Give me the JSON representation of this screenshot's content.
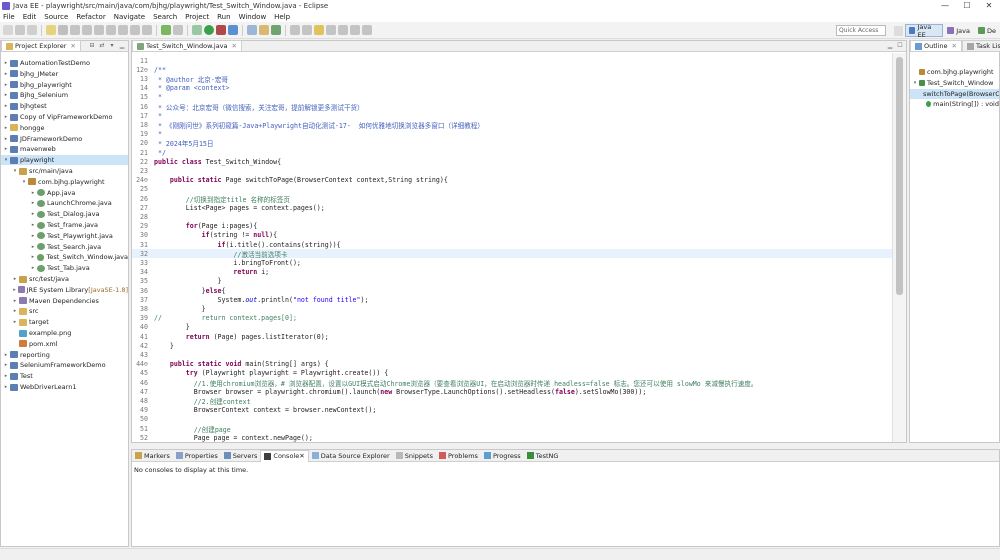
{
  "window": {
    "title": "Java EE - playwright/src/main/java/com/bjhg/playwright/Test_Switch_Window.java - Eclipse"
  },
  "menu": [
    "File",
    "Edit",
    "Source",
    "Refactor",
    "Navigate",
    "Search",
    "Project",
    "Run",
    "Window",
    "Help"
  ],
  "toolbar": {
    "quick_access": "Quick Access"
  },
  "perspectives": [
    {
      "label": "Java EE",
      "active": true
    },
    {
      "label": "Java",
      "active": false
    },
    {
      "label": "De",
      "active": false
    }
  ],
  "project_explorer": {
    "tab_label": "Project Explorer",
    "items": [
      {
        "label": "AutomationTestDemo",
        "depth": 0,
        "arrow": "▸",
        "icon": "project"
      },
      {
        "label": "bjhg_JMeter",
        "depth": 0,
        "arrow": "▸",
        "icon": "project"
      },
      {
        "label": "bjhg_playwright",
        "depth": 0,
        "arrow": "▸",
        "icon": "project"
      },
      {
        "label": "Bjhg_Selenium",
        "depth": 0,
        "arrow": "▸",
        "icon": "project"
      },
      {
        "label": "bjhgtest",
        "depth": 0,
        "arrow": "▸",
        "icon": "project"
      },
      {
        "label": "Copy of VipFrameworkDemo",
        "depth": 0,
        "arrow": "▸",
        "icon": "project"
      },
      {
        "label": "hongge",
        "depth": 0,
        "arrow": "▸",
        "icon": "folder"
      },
      {
        "label": "JDFrameworkDemo",
        "depth": 0,
        "arrow": "▸",
        "icon": "project"
      },
      {
        "label": "mavenweb",
        "depth": 0,
        "arrow": "▸",
        "icon": "project"
      },
      {
        "label": "playwright",
        "depth": 0,
        "arrow": "▾",
        "icon": "project",
        "selected": true
      },
      {
        "label": "src/main/java",
        "depth": 1,
        "arrow": "▾",
        "icon": "srcfolder"
      },
      {
        "label": "com.bjhg.playwright",
        "depth": 2,
        "arrow": "▾",
        "icon": "package"
      },
      {
        "label": "App.java",
        "depth": 3,
        "arrow": "▸",
        "icon": "java"
      },
      {
        "label": "LaunchChrome.java",
        "depth": 3,
        "arrow": "▸",
        "icon": "java"
      },
      {
        "label": "Test_Dialog.java",
        "depth": 3,
        "arrow": "▸",
        "icon": "java"
      },
      {
        "label": "Test_frame.java",
        "depth": 3,
        "arrow": "▸",
        "icon": "java"
      },
      {
        "label": "Test_Playwright.java",
        "depth": 3,
        "arrow": "▸",
        "icon": "java"
      },
      {
        "label": "Test_Search.java",
        "depth": 3,
        "arrow": "▸",
        "icon": "java"
      },
      {
        "label": "Test_Switch_Window.java",
        "depth": 3,
        "arrow": "▸",
        "icon": "java"
      },
      {
        "label": "Test_Tab.java",
        "depth": 3,
        "arrow": "▸",
        "icon": "java"
      },
      {
        "label": "src/test/java",
        "depth": 1,
        "arrow": "▸",
        "icon": "srcfolder"
      },
      {
        "label": "JRE System Library",
        "decoration": "[JavaSE-1.8]",
        "depth": 1,
        "arrow": "▸",
        "icon": "library"
      },
      {
        "label": "Maven Dependencies",
        "depth": 1,
        "arrow": "▸",
        "icon": "library"
      },
      {
        "label": "src",
        "depth": 1,
        "arrow": "▸",
        "icon": "folder"
      },
      {
        "label": "target",
        "depth": 1,
        "arrow": "▸",
        "icon": "folder"
      },
      {
        "label": "example.png",
        "depth": 1,
        "arrow": "",
        "icon": "image"
      },
      {
        "label": "pom.xml",
        "depth": 1,
        "arrow": "",
        "icon": "xml"
      },
      {
        "label": "reporting",
        "depth": 0,
        "arrow": "▸",
        "icon": "project"
      },
      {
        "label": "SeleniumFrameworkDemo",
        "depth": 0,
        "arrow": "▸",
        "icon": "project"
      },
      {
        "label": "Test",
        "depth": 0,
        "arrow": "▸",
        "icon": "project"
      },
      {
        "label": "WebDriverLearn1",
        "depth": 0,
        "arrow": "▸",
        "icon": "project"
      }
    ]
  },
  "editor": {
    "tab_label": "Test_Switch_Window.java",
    "highlight_line": 32,
    "lines": [
      {
        "n": "11",
        "t": "",
        "c": ""
      },
      {
        "n": "12⊖",
        "t": "/**",
        "c": "jd"
      },
      {
        "n": "13",
        "t": " * @author 北京-宏哥",
        "c": "jd"
      },
      {
        "n": "14",
        "t": " * @param <context>",
        "c": "jd"
      },
      {
        "n": "15",
        "t": " *",
        "c": "jd"
      },
      {
        "n": "16",
        "t": " * 公众号：北京宏哥（微信搜索，关注宏哥，提前解锁更多测试干货）",
        "c": "jd"
      },
      {
        "n": "17",
        "t": " *",
        "c": "jd"
      },
      {
        "n": "18",
        "t": " * 《刚刚问世》系列初窥篇-Java+Playwright自动化测试-17-  如何优雅地切换浏览器多窗口（详细教程）",
        "c": "jd"
      },
      {
        "n": "19",
        "t": " *",
        "c": "jd"
      },
      {
        "n": "20",
        "t": " * 2024年5月15日",
        "c": "jd"
      },
      {
        "n": "21",
        "t": " */",
        "c": "jd"
      },
      {
        "n": "22",
        "t": "public class Test_Switch_Window{",
        "c": ""
      },
      {
        "n": "23",
        "t": "",
        "c": ""
      },
      {
        "n": "24⊖",
        "t": "    public static Page switchToPage(BrowserContext context,String string){",
        "c": ""
      },
      {
        "n": "25",
        "t": "",
        "c": ""
      },
      {
        "n": "26",
        "t": "        //切换到指定title 名称的标签页",
        "c": "cm"
      },
      {
        "n": "27",
        "t": "        List<Page> pages = context.pages();",
        "c": ""
      },
      {
        "n": "28",
        "t": "",
        "c": ""
      },
      {
        "n": "29",
        "t": "        for(Page i:pages){",
        "c": ""
      },
      {
        "n": "30",
        "t": "            if(string != null){",
        "c": ""
      },
      {
        "n": "31",
        "t": "                if(i.title().contains(string)){",
        "c": ""
      },
      {
        "n": "32",
        "t": "                    //激活当前选项卡",
        "c": "cm"
      },
      {
        "n": "33",
        "t": "                    i.bringToFront();",
        "c": ""
      },
      {
        "n": "34",
        "t": "                    return i;",
        "c": ""
      },
      {
        "n": "35",
        "t": "                }",
        "c": ""
      },
      {
        "n": "36",
        "t": "            }else{",
        "c": ""
      },
      {
        "n": "37",
        "t": "                System.out.println(\"not found title\");",
        "c": ""
      },
      {
        "n": "38",
        "t": "            }",
        "c": ""
      },
      {
        "n": "39",
        "t": "//          return context.pages[0];",
        "c": "cm"
      },
      {
        "n": "40",
        "t": "        }",
        "c": ""
      },
      {
        "n": "41",
        "t": "        return (Page) pages.listIterator(0);",
        "c": ""
      },
      {
        "n": "42",
        "t": "    }",
        "c": ""
      },
      {
        "n": "43",
        "t": "",
        "c": ""
      },
      {
        "n": "44⊖",
        "t": "    public static void main(String[] args) {",
        "c": ""
      },
      {
        "n": "45",
        "t": "        try (Playwright playwright = Playwright.create()) {",
        "c": ""
      },
      {
        "n": "46",
        "t": "          //1.使用chromium浏览器，# 浏览器配置，设置以GUI模式启动Chrome浏览器（要查看浏览器UI，在启动浏览器时传递 headless=false 标志。您还可以使用 slowMo 来减慢执行速度。",
        "c": "cm"
      },
      {
        "n": "47",
        "t": "          Browser browser = playwright.chromium().launch(new BrowserType.LaunchOptions().setHeadless(false).setSlowMo(300));",
        "c": ""
      },
      {
        "n": "48",
        "t": "          //2.创建context",
        "c": "cm"
      },
      {
        "n": "49",
        "t": "          BrowserContext context = browser.newContext();",
        "c": ""
      },
      {
        "n": "50",
        "t": "",
        "c": ""
      },
      {
        "n": "51",
        "t": "          //创建page",
        "c": "cm"
      },
      {
        "n": "52",
        "t": "          Page page = context.newPage();",
        "c": ""
      }
    ]
  },
  "outline": {
    "tabs": [
      "Outline",
      "Task List"
    ],
    "items": [
      {
        "label": "com.bjhg.playwright",
        "depth": 0,
        "icon": "package"
      },
      {
        "label": "Test_Switch_Window",
        "depth": 0,
        "icon": "class",
        "arrow": "▾"
      },
      {
        "label": "switchToPage(BrowserContext, String) : Page",
        "depth": 1,
        "icon": "method",
        "selected": true
      },
      {
        "label": "main(String[]) : void",
        "depth": 1,
        "icon": "method"
      }
    ]
  },
  "bottom_panel": {
    "tabs": [
      {
        "label": "Markers",
        "active": false
      },
      {
        "label": "Properties",
        "active": false
      },
      {
        "label": "Servers",
        "active": false
      },
      {
        "label": "Console",
        "active": true
      },
      {
        "label": "Data Source Explorer",
        "active": false
      },
      {
        "label": "Snippets",
        "active": false
      },
      {
        "label": "Problems",
        "active": false
      },
      {
        "label": "Progress",
        "active": false
      },
      {
        "label": "TestNG",
        "active": false
      }
    ],
    "message": "No consoles to display at this time."
  },
  "colors": {
    "accent": "#cce4f7",
    "keyword": "#7f0055",
    "comment": "#3f7f5f",
    "javadoc": "#3f5fbf",
    "string": "#2a00ff"
  }
}
